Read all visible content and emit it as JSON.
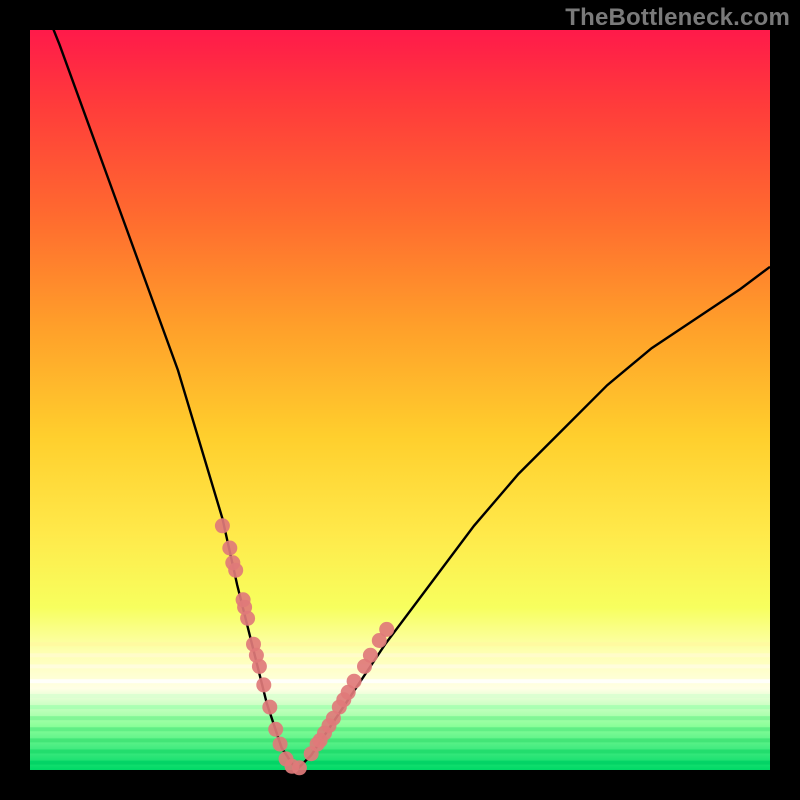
{
  "watermark": "TheBottleneck.com",
  "chart_data": {
    "type": "line",
    "title": "",
    "xlabel": "",
    "ylabel": "",
    "xlim": [
      0,
      100
    ],
    "ylim": [
      0,
      100
    ],
    "series": [
      {
        "name": "bottleneck-curve",
        "x": [
          0,
          4,
          8,
          12,
          16,
          20,
          23,
          26,
          28,
          30,
          32,
          34,
          36,
          38,
          42,
          48,
          54,
          60,
          66,
          72,
          78,
          84,
          90,
          96,
          100
        ],
        "y": [
          108,
          98,
          87,
          76,
          65,
          54,
          44,
          34,
          25,
          17,
          9,
          3,
          0,
          2,
          8,
          17,
          25,
          33,
          40,
          46,
          52,
          57,
          61,
          65,
          68
        ]
      },
      {
        "name": "scatter-dots",
        "x": [
          26.0,
          27.0,
          27.4,
          27.8,
          28.8,
          29.0,
          29.4,
          30.2,
          30.6,
          31.0,
          31.6,
          32.4,
          33.2,
          33.8,
          34.6,
          35.4,
          36.4,
          38.0,
          38.8,
          39.2,
          39.8,
          40.4,
          41.0,
          41.8,
          42.4,
          43.0,
          43.8,
          45.2,
          46.0,
          47.2,
          48.2
        ],
        "y": [
          33.0,
          30.0,
          28.0,
          27.0,
          23.0,
          22.0,
          20.5,
          17.0,
          15.5,
          14.0,
          11.5,
          8.5,
          5.5,
          3.5,
          1.5,
          0.5,
          0.3,
          2.2,
          3.5,
          4.0,
          5.0,
          6.0,
          7.0,
          8.5,
          9.5,
          10.5,
          12.0,
          14.0,
          15.5,
          17.5,
          19.0
        ]
      }
    ],
    "background_gradient_stops": [
      {
        "pos": 0,
        "color": "#ff1a4a"
      },
      {
        "pos": 10,
        "color": "#ff3b3b"
      },
      {
        "pos": 25,
        "color": "#ff6a2f"
      },
      {
        "pos": 40,
        "color": "#ff9f2a"
      },
      {
        "pos": 55,
        "color": "#ffcf2d"
      },
      {
        "pos": 68,
        "color": "#ffe94a"
      },
      {
        "pos": 78,
        "color": "#f7ff5e"
      },
      {
        "pos": 84,
        "color": "#fdffb0"
      },
      {
        "pos": 89,
        "color": "#ffffe5"
      },
      {
        "pos": 94,
        "color": "#8cff9a"
      },
      {
        "pos": 100,
        "color": "#00d967"
      }
    ],
    "horizontal_strips": [
      {
        "y_pct": 83.0,
        "color": "#fff9a0"
      },
      {
        "y_pct": 84.5,
        "color": "#fffccc"
      },
      {
        "y_pct": 86.0,
        "color": "#fffde0"
      },
      {
        "y_pct": 88.0,
        "color": "#ffffff"
      },
      {
        "y_pct": 90.0,
        "color": "#d9ffd0"
      },
      {
        "y_pct": 91.5,
        "color": "#a5ffb0"
      },
      {
        "y_pct": 93.0,
        "color": "#7cf593"
      },
      {
        "y_pct": 94.5,
        "color": "#5cec82"
      },
      {
        "y_pct": 96.0,
        "color": "#3ee374"
      },
      {
        "y_pct": 97.5,
        "color": "#1fda6b"
      },
      {
        "y_pct": 99.0,
        "color": "#00d164"
      }
    ],
    "dot_color": "#e07a7a",
    "curve_color": "#000000"
  }
}
